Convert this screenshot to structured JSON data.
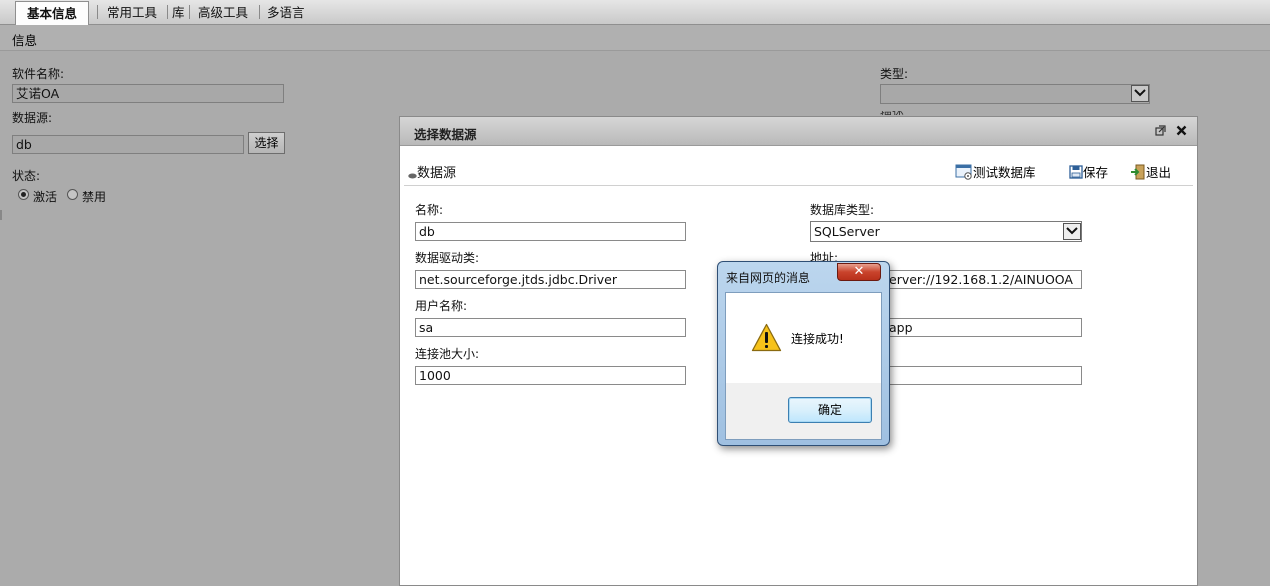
{
  "tabs": [
    {
      "label": "基本信息",
      "active": true
    },
    {
      "label": "常用工具",
      "active": false
    },
    {
      "label": "库",
      "active": false
    },
    {
      "label": "高级工具",
      "active": false
    },
    {
      "label": "多语言",
      "active": false
    }
  ],
  "section_title": "信息",
  "form": {
    "software_name_label": "软件名称:",
    "software_name_value": "艾诺OA",
    "datasource_label": "数据源:",
    "datasource_value": "db",
    "select_button": "选择",
    "status_label": "状态:",
    "status_active": "激活",
    "status_disabled": "禁用",
    "status_selected": "激活",
    "type_label": "类型:",
    "type_value": ""
  },
  "dialog": {
    "title": "选择数据源",
    "section_label": "数据源",
    "toolbar": {
      "test": "测试数据库",
      "save": "保存",
      "exit": "退出"
    },
    "fields": {
      "name_label": "名称:",
      "name_value": "db",
      "driver_label": "数据驱动类:",
      "driver_value": "net.sourceforge.jtds.jdbc.Driver",
      "user_label": "用户名称:",
      "user_value": "sa",
      "pool_label": "连接池大小:",
      "pool_value": "1000",
      "dbtype_label": "数据库类型:",
      "dbtype_value": "SQLServer",
      "address_label": "地址:",
      "address_value": "erver://192.168.1.2/AINUOOA",
      "field6_value": "app",
      "field8_value": ""
    }
  },
  "message_box": {
    "title": "来自网页的消息",
    "close_glyph": "✕",
    "message": "连接成功!",
    "ok_button": "确定"
  },
  "icons": {
    "warning": "warning-icon",
    "test_db": "database-test-icon",
    "save": "floppy-icon",
    "exit": "exit-icon",
    "restore": "restore-icon",
    "close": "close-icon"
  }
}
